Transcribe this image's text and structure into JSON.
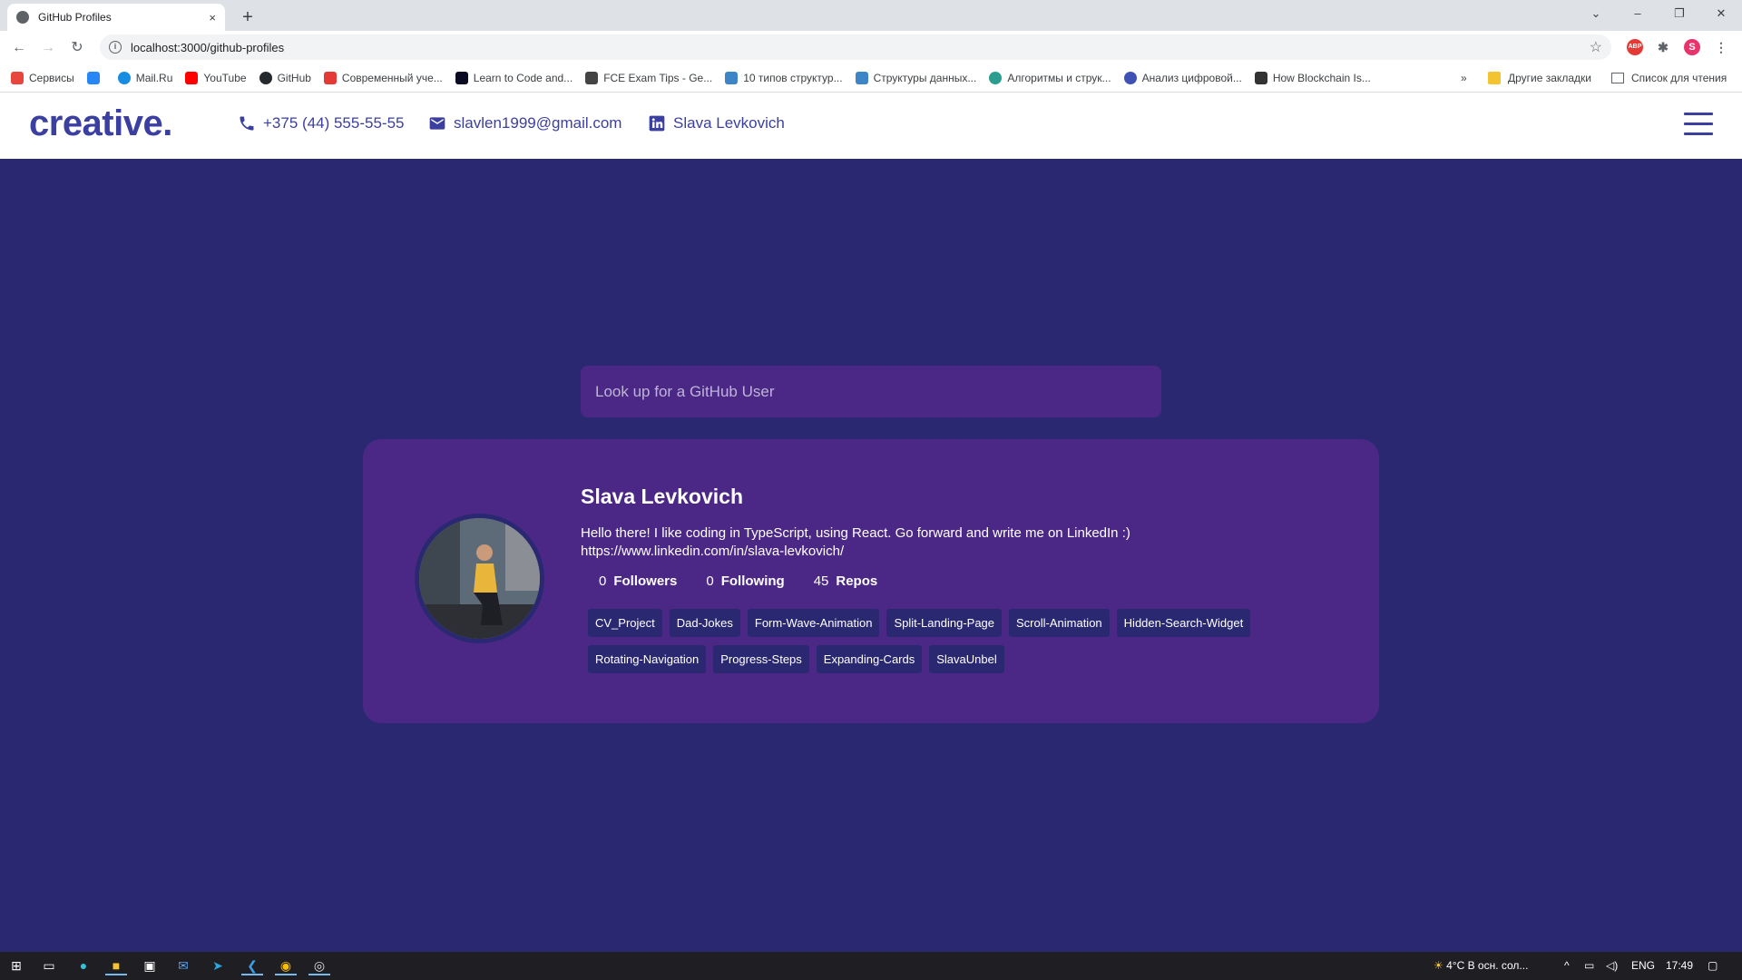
{
  "browser": {
    "tab_title": "GitHub Profiles",
    "tab_close": "×",
    "new_tab": "+",
    "url": "localhost:3000/github-profiles",
    "controls": {
      "minimize": "–",
      "maximize": "❐",
      "close": "✕",
      "tablist": "⌄"
    },
    "bookmarks": [
      {
        "label": "Сервисы",
        "color": "#e8453c"
      },
      {
        "label": "",
        "color": "#2787f5"
      },
      {
        "label": "Mail.Ru",
        "color": "#168de2"
      },
      {
        "label": "YouTube",
        "color": "#ff0000"
      },
      {
        "label": "GitHub",
        "color": "#24292e"
      },
      {
        "label": "Современный уче...",
        "color": "#e53935"
      },
      {
        "label": "Learn to Code and...",
        "color": "#0a0a23"
      },
      {
        "label": "FCE Exam Tips - Ge...",
        "color": "#444"
      },
      {
        "label": "10 типов структур...",
        "color": "#3d85c6"
      },
      {
        "label": "Структуры данных...",
        "color": "#3d85c6"
      },
      {
        "label": "Алгоритмы и струк...",
        "color": "#2a9d8f"
      },
      {
        "label": "Анализ цифровой...",
        "color": "#3f51b5"
      },
      {
        "label": "How Blockchain Is...",
        "color": "#333"
      }
    ],
    "bookmarks_more": "»",
    "other_bookmarks": "Другие закладки",
    "reading_list": "Список для чтения",
    "profile_initial": "S",
    "abp": "ABP"
  },
  "site": {
    "logo": "creative.",
    "phone": "+375 (44) 555-55-55",
    "email": "slavlen1999@gmail.com",
    "linkedin": "Slava Levkovich"
  },
  "search": {
    "placeholder": "Look up for a GitHub User"
  },
  "profile": {
    "name": "Slava Levkovich",
    "bio": "Hello there! I like coding in TypeScript, using React. Go forward and write me on LinkedIn :) https://www.linkedin.com/in/slava-levkovich/",
    "followers_count": "0",
    "followers_label": "Followers",
    "following_count": "0",
    "following_label": "Following",
    "repos_count": "45",
    "repos_label": "Repos",
    "repos": [
      "CV_Project",
      "Dad-Jokes",
      "Form-Wave-Animation",
      "Split-Landing-Page",
      "Scroll-Animation",
      "Hidden-Search-Widget",
      "Rotating-Navigation",
      "Progress-Steps",
      "Expanding-Cards",
      "SlavaUnbel"
    ]
  },
  "taskbar": {
    "weather": "4°C  В осн. сол...",
    "lang": "ENG",
    "time": "17:49"
  }
}
